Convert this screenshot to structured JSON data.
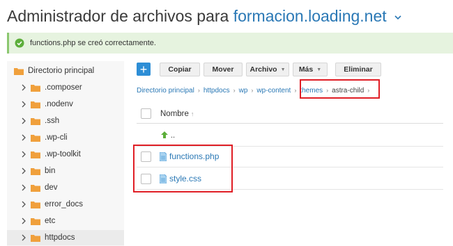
{
  "header": {
    "title_prefix": "Administrador de archivos para ",
    "domain": "formacion.loading.net"
  },
  "banner": {
    "message": "functions.php se creó correctamente.",
    "color": "#e6f3df"
  },
  "sidebar": {
    "root_label": "Directorio principal",
    "items": [
      {
        "label": ".composer"
      },
      {
        "label": ".nodenv"
      },
      {
        "label": ".ssh"
      },
      {
        "label": ".wp-cli"
      },
      {
        "label": ".wp-toolkit"
      },
      {
        "label": "bin"
      },
      {
        "label": "dev"
      },
      {
        "label": "error_docs"
      },
      {
        "label": "etc"
      },
      {
        "label": "httpdocs",
        "selected": true
      }
    ]
  },
  "toolbar": {
    "add_label": "+",
    "copy_label": "Copiar",
    "move_label": "Mover",
    "file_label": "Archivo",
    "more_label": "Más",
    "delete_label": "Eliminar",
    "accent": "#2d8ed6"
  },
  "breadcrumb": [
    "Directorio principal",
    "httpdocs",
    "wp",
    "wp-content",
    "themes",
    "astra-child"
  ],
  "list": {
    "header_name": "Nombre",
    "parent_label": "..",
    "files": [
      {
        "name": "functions.php",
        "icon": "php-file-icon"
      },
      {
        "name": "style.css",
        "icon": "css-file-icon"
      }
    ]
  },
  "colors": {
    "link": "#2a78b5",
    "highlight": "#e01e25",
    "folder": "#f0a03c"
  }
}
